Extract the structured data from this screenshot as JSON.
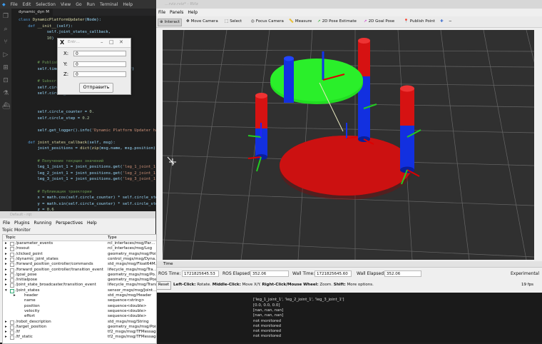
{
  "vscode": {
    "menu": [
      "File",
      "Edit",
      "Selection",
      "View",
      "Go",
      "Run",
      "Terminal",
      "Help"
    ],
    "tab_label": "dynamic_dyn M"
  },
  "dialog": {
    "title": "Entr…",
    "fields": [
      {
        "label": "X:",
        "value": "0"
      },
      {
        "label": "Y:",
        "value": "0"
      },
      {
        "label": "Z:",
        "value": "0"
      }
    ],
    "send_label": "Отправить"
  },
  "rviz": {
    "window_title": "…rviz.rviz* - RViz",
    "menu": [
      "File",
      "Panels",
      "Help"
    ],
    "tools": [
      "Interact",
      "Move Camera",
      "Select",
      "Focus Camera",
      "Measure",
      "2D Pose Estimate",
      "2D Goal Pose",
      "Publish Point"
    ],
    "time": {
      "header": "Time",
      "ros_time_label": "ROS Time:",
      "ros_time": "1721825645.53",
      "ros_elapsed_label": "ROS Elapsed:",
      "ros_elapsed": "352.06",
      "wall_time_label": "Wall Time:",
      "wall_time": "1721825645.60",
      "wall_elapsed_label": "Wall Elapsed:",
      "wall_elapsed": "352.06",
      "experimental": "Experimental",
      "fps": "19 fps",
      "reset_label": "Reset",
      "help_bold1": "Left-Click:",
      "help1": " Rotate. ",
      "help_bold2": "Middle-Click:",
      "help2": " Move X/Y. ",
      "help_bold3": "Right-Click/Mouse Wheel:",
      "help3": " Zoom. ",
      "help_bold4": "Shift:",
      "help4": " More options."
    }
  },
  "rqt": {
    "title": "Default - rqt",
    "menu": [
      "File",
      "Plugins",
      "Running",
      "Perspectives",
      "Help"
    ],
    "plugin_title": "Topic Monitor",
    "columns": [
      "Topic",
      "Type"
    ],
    "rows": [
      {
        "topic": "/parameter_events",
        "type": "rcl_interfaces/msg/Par…",
        "value": "",
        "indent": 0,
        "expander": "▸"
      },
      {
        "topic": "/rosout",
        "type": "rcl_interfaces/msg/Log",
        "value": "",
        "indent": 0,
        "expander": "▸"
      },
      {
        "topic": "/clicked_point",
        "type": "geometry_msgs/msg/Poi…",
        "value": "",
        "indent": 0,
        "expander": "▸"
      },
      {
        "topic": "/dynamic_joint_states",
        "type": "control_msgs/msg/Dyna…",
        "value": "",
        "indent": 0,
        "expander": "▸"
      },
      {
        "topic": "/forward_position_controller/commands",
        "type": "std_msgs/msg/Float64M…",
        "value": "",
        "indent": 0,
        "expander": "▸"
      },
      {
        "topic": "/forward_position_controller/transition_event",
        "type": "lifecycle_msgs/msg/Tra…",
        "value": "",
        "indent": 0,
        "expander": "▸"
      },
      {
        "topic": "/goal_pose",
        "type": "geometry_msgs/msg/Po…",
        "value": "",
        "indent": 0,
        "expander": "▸"
      },
      {
        "topic": "/initialpose",
        "type": "geometry_msgs/msg/Pos…",
        "value": "",
        "indent": 0,
        "expander": "▸"
      },
      {
        "topic": "/joint_state_broadcaster/transition_event",
        "type": "lifecycle_msgs/msg/Transi…",
        "value": "",
        "indent": 0,
        "expander": "▸"
      },
      {
        "topic": "/joint_states",
        "type": "sensor_msgs/msg/Joint…",
        "value": "",
        "indent": 0,
        "expander": "▾"
      },
      {
        "topic": "header",
        "type": "std_msgs/msg/Header",
        "value": "",
        "indent": 1,
        "expander": "▸"
      },
      {
        "topic": "name",
        "type": "sequence<string>",
        "value": "['leg_1_joint_1', 'leg_2_joint_1', 'leg_3_joint_1']",
        "indent": 1,
        "expander": ""
      },
      {
        "topic": "position",
        "type": "sequence<double>",
        "value": "[0.0, 0.0, 0.0]",
        "indent": 1,
        "expander": ""
      },
      {
        "topic": "velocity",
        "type": "sequence<double>",
        "value": "[nan, nan, nan]",
        "indent": 1,
        "expander": ""
      },
      {
        "topic": "effort",
        "type": "sequence<double>",
        "value": "[nan, nan, nan]",
        "indent": 1,
        "expander": ""
      },
      {
        "topic": "/robot_description",
        "type": "std_msgs/msg/String",
        "value": "not monitored",
        "indent": 0,
        "expander": "▸"
      },
      {
        "topic": "/target_position",
        "type": "geometry_msgs/msg/Point",
        "value": "not monitored",
        "indent": 0,
        "expander": "▸"
      },
      {
        "topic": "/tf",
        "type": "tf2_msgs/msg/TFMessage",
        "value": "not monitored",
        "indent": 0,
        "expander": "▸"
      },
      {
        "topic": "/tf_static",
        "type": "tf2_msgs/msg/TFMessage",
        "value": "not monitored",
        "indent": 0,
        "expander": "▸"
      }
    ]
  },
  "colors": {
    "platform_top": "#22dd22",
    "platform_base": "#cc1111",
    "leg_red": "#dd1111",
    "leg_blue": "#1133ee",
    "grid": "#6a6a6a",
    "viewport_bg": "#303030"
  }
}
